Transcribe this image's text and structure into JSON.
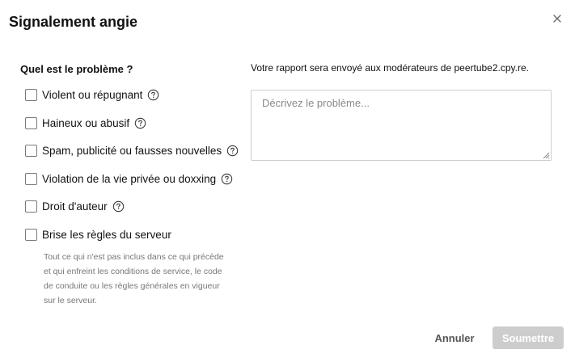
{
  "modal": {
    "title": "Signalement angie"
  },
  "reasons_section": {
    "title": "Quel est le problème ?",
    "items": [
      {
        "label": "Violent ou répugnant",
        "has_help": true,
        "checked": false
      },
      {
        "label": "Haineux ou abusif",
        "has_help": true,
        "checked": false
      },
      {
        "label": "Spam, publicité ou fausses nouvelles",
        "has_help": true,
        "checked": false
      },
      {
        "label": "Violation de la vie privée ou doxxing",
        "has_help": true,
        "checked": false
      },
      {
        "label": "Droit d'auteur",
        "has_help": true,
        "checked": false
      },
      {
        "label": "Brise les règles du serveur",
        "has_help": false,
        "checked": false
      }
    ],
    "server_rules_description": "Tout ce qui n'est pas inclus dans ce qui précède et qui enfreint les conditions de service, le code de conduite ou les règles générales en vigueur sur le serveur."
  },
  "report": {
    "info_text": "Votre rapport sera envoyé aux modérateurs de peertube2.cpy.re.",
    "textarea_placeholder": "Décrivez le problème...",
    "textarea_value": ""
  },
  "footer": {
    "cancel_label": "Annuler",
    "submit_label": "Soumettre",
    "submit_disabled": true
  },
  "icons": {
    "close": "close-icon",
    "help": "help-circle-icon",
    "resize": "resize-grip-icon"
  },
  "colors": {
    "submit_disabled_bg": "#cdcdcd",
    "muted_text": "#777777",
    "border": "#cfcfcf"
  }
}
